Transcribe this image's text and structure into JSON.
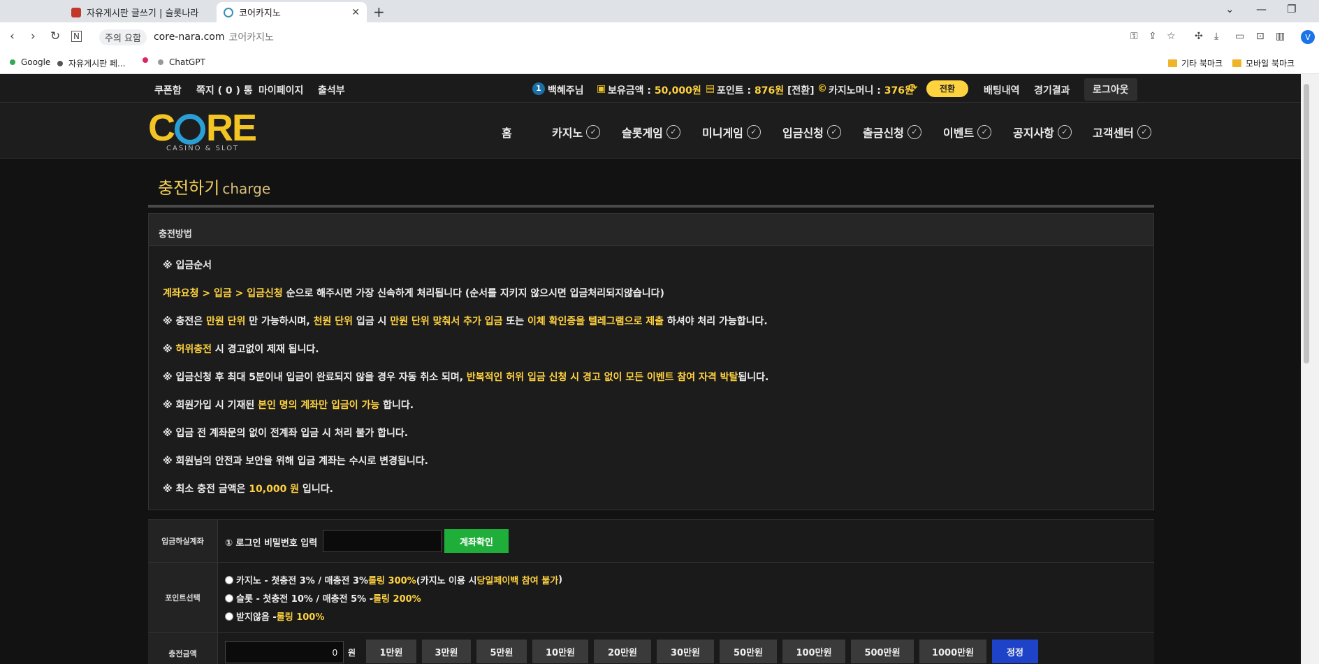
{
  "browser": {
    "tabs": [
      {
        "label": "자유게시판 글쓰기 | 슬롯나라"
      },
      {
        "label": "코어카지노"
      }
    ],
    "warning": "주의 요함",
    "url": "core-nara.com",
    "url_title": "코어카지노",
    "profile": "V",
    "bookmarks": [
      "Google",
      "자유게시판 페...",
      "ChatGPT"
    ],
    "bookmark_folders": [
      "기타 북마크",
      "모바일 북마크"
    ]
  },
  "topbar": {
    "links": [
      "쿠폰함",
      "쪽지 ( 0 ) 통",
      "마이페이지",
      "출석부"
    ],
    "level": "1",
    "user": "백혜주님",
    "balance_label": "보유금액 : ",
    "balance": "50,000원",
    "point_label": "포인트 : ",
    "point": "876원",
    "point_convert": "[전환]",
    "casino_label": "카지노머니 : ",
    "casino_money": "376원",
    "convert_button": "전환",
    "bet_history": "배팅내역",
    "results": "경기결과",
    "logout": "로그아웃"
  },
  "logo": {
    "text_c": "C",
    "text_re": "RE",
    "sub": "CASINO & SLOT"
  },
  "nav": [
    "홈",
    "카지노",
    "슬롯게임",
    "미니게임",
    "입금신청",
    "출금신청",
    "이벤트",
    "공지사항",
    "고객센터"
  ],
  "page": {
    "title": "충전하기",
    "title_en": "charge"
  },
  "method": {
    "header": "충전방법",
    "order_title": "※ 입금순서",
    "l1a": "계좌요청 > 입금 > 입금신청",
    "l1b": " 순으로 해주시면 가장 신속하게 처리됩니다 (순서를 지키지 않으시면 입금처리되지않습니다)",
    "l2a": "※ 충전은 ",
    "l2b": "만원 단위",
    "l2c": " 만 가능하시며, ",
    "l2d": "천원 단위",
    "l2e": " 입금 시 ",
    "l2f": "만원 단위 맞춰서 추가 입금",
    "l2g": " 또는 ",
    "l2h": "이체 확인증을 텔레그램으로 제출",
    "l2i": " 하셔야 처리 가능합니다.",
    "l3a": "※ ",
    "l3b": "허위충전",
    "l3c": " 시 경고없이 제재 됩니다.",
    "l4a": "※ 입금신청 후 최대 5분이내 입금이 완료되지 않을 경우 자동 취소 되며, ",
    "l4b": "반복적인 허위 입금 신청 시 경고 없이 모든 이벤트 참여 자격 박탈",
    "l4c": "됩니다.",
    "l5a": "※ 회원가입 시 기재된 ",
    "l5b": "본인 명의 계좌만 입금이 가능",
    "l5c": " 합니다.",
    "l6": "※ 입금 전 계좌문의 없이 전계좌 입금 시 처리 불가 합니다.",
    "l7": "※ 회원님의 안전과 보안을 위해 입금 계좌는 수시로 변경됩니다.",
    "l8a": "※ 최소 충전 금액은 ",
    "l8b": "10,000 원",
    "l8c": " 입니다."
  },
  "form": {
    "account_label": "입금하실계좌",
    "pw_label": "① 로그인 비밀번호 입력",
    "account_button": "계좌확인",
    "point_label": "포인트선택",
    "opt1a": "카지노 - 첫충전 3% / 매충전 3% ",
    "opt1b": "롤링 300%",
    "opt1c": " (카지노 이용 시 ",
    "opt1d": "당일페이백 참여 불가",
    "opt1e": ")",
    "opt2a": "슬롯 - 첫충전 10% / 매충전 5% - ",
    "opt2b": "롤링 200%",
    "opt3a": "받지않음 - ",
    "opt3b": "롤링 100%",
    "amount_label": "충전금액",
    "amount_value": "0",
    "won": "원",
    "amount_buttons": [
      "1만원",
      "3만원",
      "5만원",
      "10만원",
      "20만원",
      "30만원",
      "50만원",
      "100만원",
      "500만원",
      "1000만원"
    ],
    "reset": "정정"
  },
  "colors": {
    "accent_yellow": "#ffd23f",
    "green": "#1fae3a",
    "blue": "#1e43c8"
  }
}
